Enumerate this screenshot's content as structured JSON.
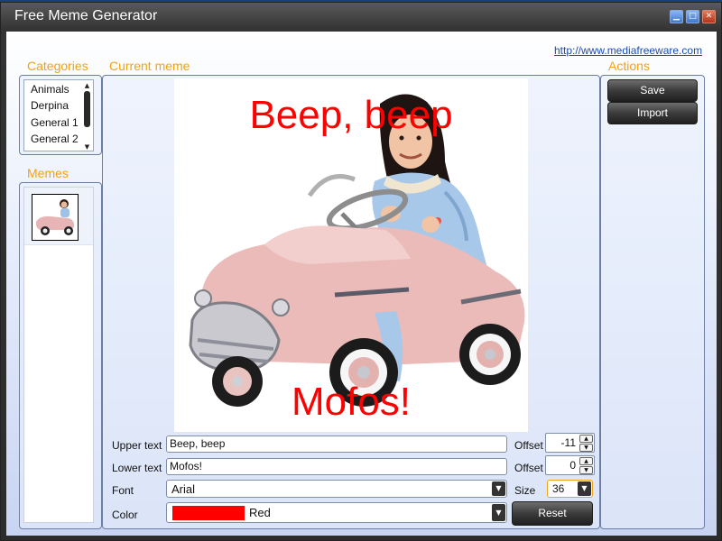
{
  "window": {
    "title": "Free Meme Generator",
    "minimize_glyph": "▁",
    "maximize_glyph": "□",
    "close_glyph": "✕"
  },
  "header": {
    "link": "http://www.mediafreeware.com"
  },
  "categories": {
    "label": "Categories",
    "items": [
      "Animals",
      "Derpina",
      "General 1",
      "General 2"
    ],
    "scroll_up": "▲",
    "scroll_down": "▼"
  },
  "memes": {
    "label": "Memes"
  },
  "current_meme": {
    "label": "Current meme",
    "upper_text": "Beep, beep",
    "lower_text": "Mofos!"
  },
  "form": {
    "upper_text_label": "Upper text",
    "upper_text_value": "Beep, beep",
    "lower_text_label": "Lower text",
    "lower_text_value": "Mofos!",
    "offset_label": "Offset",
    "upper_offset": "-11",
    "lower_offset": "0",
    "font_label": "Font",
    "font_value": "Arial",
    "size_label": "Size",
    "size_value": "36",
    "color_label": "Color",
    "color_name": "Red",
    "color_swatch": "#ff0000",
    "reset_label": "Reset",
    "spin_up": "▲",
    "spin_down": "▼",
    "dropdown": "▼"
  },
  "actions": {
    "label": "Actions",
    "save_label": "Save",
    "import_label": "Import"
  }
}
